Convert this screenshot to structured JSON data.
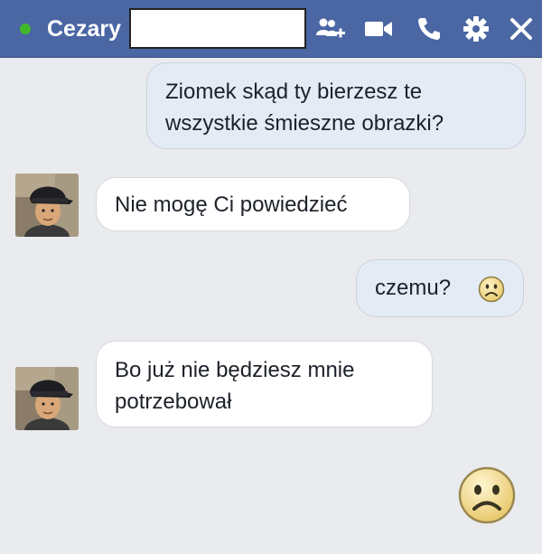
{
  "header": {
    "contact_name": "Cezary",
    "status_color": "#42b72a",
    "background": "#4a66a3",
    "icons": [
      "add-person-icon",
      "video-call-icon",
      "phone-icon",
      "gear-icon",
      "close-icon"
    ]
  },
  "messages": [
    {
      "direction": "outgoing",
      "lines": [
        "Ziomek skąd ty bierzesz te",
        "wszystkie śmieszne obrazki?"
      ]
    },
    {
      "direction": "incoming",
      "lines": [
        "Nie mogę Ci powiedzieć"
      ]
    },
    {
      "direction": "outgoing",
      "lines": [
        "czemu?"
      ],
      "emoji": "sad-face-emoji"
    },
    {
      "direction": "incoming",
      "lines": [
        "Bo już nie będziesz mnie",
        "potrzebował"
      ]
    },
    {
      "direction": "outgoing",
      "emoji": "sad-face-emoji"
    }
  ]
}
